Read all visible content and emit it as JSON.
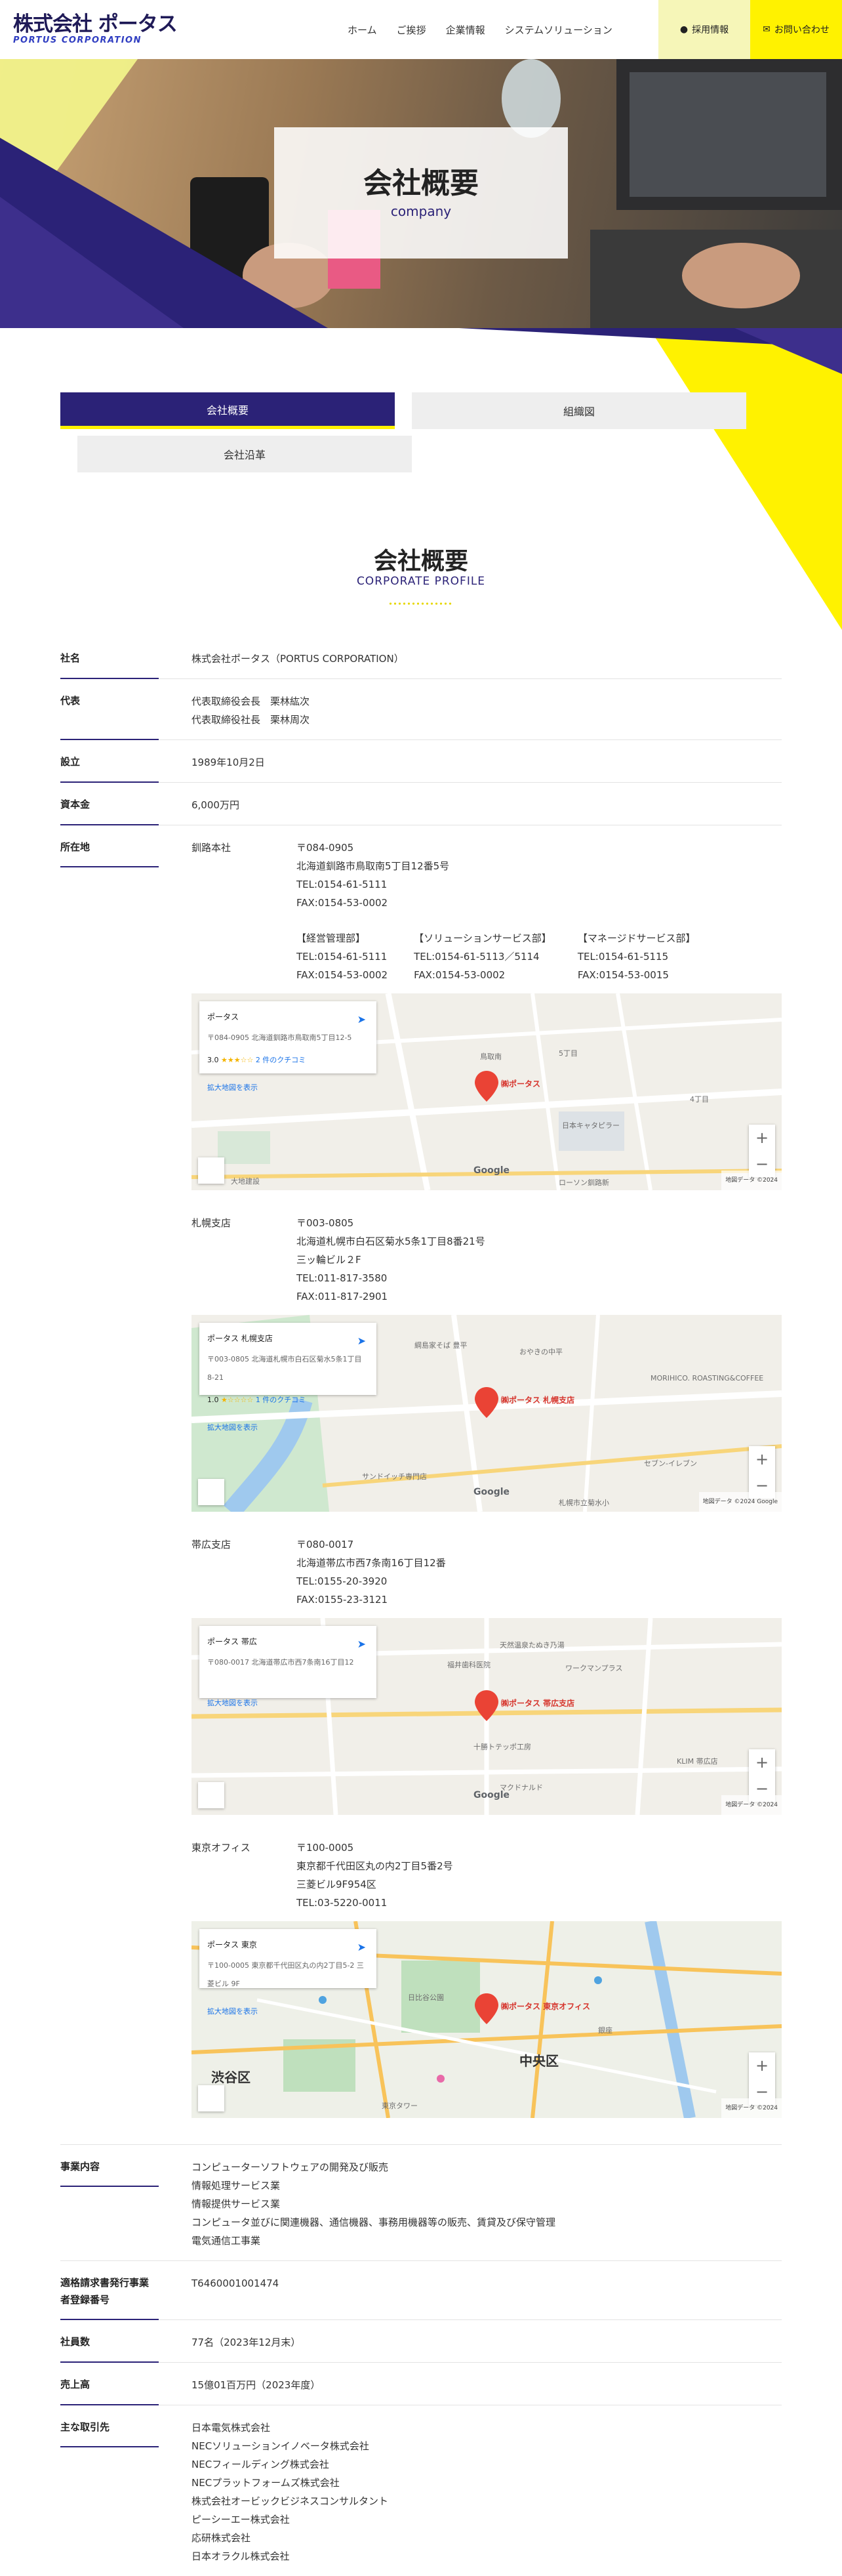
{
  "header": {
    "logo_jp": "株式会社 ポータス",
    "logo_en": "PORTUS CORPORATION",
    "nav": [
      "ホーム",
      "ご挨拶",
      "企業情報",
      "システムソリューション"
    ],
    "recruit_label": "採用情報",
    "contact_label": "お問い合わせ"
  },
  "hero": {
    "title": "会社概要",
    "subtitle": "company"
  },
  "tabs": [
    "会社概要",
    "組織図",
    "会社沿革"
  ],
  "section": {
    "title": "会社概要",
    "subtitle": "CORPORATE PROFILE"
  },
  "profile": {
    "name": {
      "label": "社名",
      "value": "株式会社ポータス（PORTUS CORPORATION）"
    },
    "rep": {
      "label": "代表",
      "lines": [
        "代表取締役会長　栗林紘次",
        "代表取締役社長　栗林周次"
      ]
    },
    "established": {
      "label": "設立",
      "value": "1989年10月2日"
    },
    "capital": {
      "label": "資本金",
      "value": "6,000万円"
    },
    "location": {
      "label": "所在地",
      "hq": {
        "name": "釧路本社",
        "lines": [
          "〒084-0905",
          "北海道釧路市鳥取南5丁目12番5号",
          "TEL:0154-61-5111",
          "FAX:0154-53-0002"
        ],
        "depts": [
          {
            "title": "【経営管理部】",
            "lines": [
              "TEL:0154-61-5111",
              "FAX:0154-53-0002"
            ]
          },
          {
            "title": "【ソリューションサービス部】",
            "lines": [
              "TEL:0154-61-5113／5114",
              "FAX:0154-53-0002"
            ]
          },
          {
            "title": "【マネージドサービス部】",
            "lines": [
              "TEL:0154-61-5115",
              "FAX:0154-53-0015"
            ]
          }
        ],
        "map_card_title": "ポータス",
        "map_card_address": "〒084-0905 北海道釧路市鳥取南5丁目12-5",
        "map_rating": "3.0",
        "map_stars": "★★★☆☆",
        "map_reviews": "2 件のクチコミ",
        "map_link": "拡大地図を表示",
        "map_dir": "ルート",
        "map_pin": "㈱ポータス",
        "map_labels": [
          "鳥取南",
          "5丁目",
          "日本キャタピラー",
          "ローソン釧路新",
          "4丁目",
          "大地建設"
        ],
        "map_copy": "地図データ ©2024"
      },
      "sapporo": {
        "name": "札幌支店",
        "lines": [
          "〒003-0805",
          "北海道札幌市白石区菊水5条1丁目8番21号",
          "三ッ輪ビル２F",
          "TEL:011-817-3580",
          "FAX:011-817-2901"
        ],
        "map_card_title": "ポータス 札幌支店",
        "map_card_address": "〒003-0805 北海道札幌市白石区菊水5条1丁目8-21",
        "map_rating": "1.0",
        "map_stars": "★☆☆☆☆",
        "map_reviews": "1 件のクチコミ",
        "map_link": "拡大地図を表示",
        "map_dir": "ルート",
        "map_pin": "㈱ポータス 札幌支店",
        "map_labels": [
          "綱島家そば 豊平",
          "おやきの中平",
          "MORIHICO. ROASTING&COFFEE",
          "セブン-イレブン",
          "札幌市立菊水小",
          "サンドイッチ専門店"
        ],
        "map_copy": "地図データ ©2024 Google"
      },
      "obihiro": {
        "name": "帯広支店",
        "lines": [
          "〒080-0017",
          "北海道帯広市西7条南16丁目12番",
          "TEL:0155-20-3920",
          "FAX:0155-23-3121"
        ],
        "map_card_title": "ポータス 帯広",
        "map_card_address": "〒080-0017 北海道帯広市西7条南16丁目12",
        "map_link": "拡大地図を表示",
        "map_dir": "ルート",
        "map_pin": "㈱ポータス 帯広支店",
        "map_labels": [
          "天然温泉たぬき乃湯",
          "福井歯科医院",
          "ワークマンプラス",
          "十勝トテッポ工房",
          "マクドナルド",
          "KLIM 帯広店"
        ],
        "map_copy": "地図データ ©2024"
      },
      "tokyo": {
        "name": "東京オフィス",
        "lines": [
          "〒100-0005",
          "東京都千代田区丸の内2丁目5番2号",
          "三菱ビル9F954区",
          "TEL:03-5220-0011"
        ],
        "map_card_title": "ポータス 東京",
        "map_card_address": "〒100-0005 東京都千代田区丸の内2丁目5-2 三菱ビル 9F",
        "map_link": "拡大地図を表示",
        "map_dir": "ルート",
        "map_pin": "㈱ポータス 東京オフィス",
        "map_labels": [
          "渋谷区",
          "中央区",
          "日比谷公園",
          "東京タワー",
          "銀座"
        ],
        "map_copy": "地図データ ©2024"
      }
    },
    "business": {
      "label": "事業内容",
      "lines": [
        "コンピューターソフトウェアの開発及び販売",
        "情報処理サービス業",
        "情報提供サービス業",
        "コンピュータ並びに関連機器、通信機器、事務用機器等の販売、賃貸及び保守管理",
        "電気通信工事業"
      ]
    },
    "invoice": {
      "label_lines": [
        "適格請求書発行事業",
        "者登録番号"
      ],
      "value": "T6460001001474"
    },
    "employees": {
      "label": "社員数",
      "value": "77名（2023年12月末）"
    },
    "sales": {
      "label": "売上高",
      "value": "15億01百万円（2023年度）"
    },
    "clients": {
      "label": "主な取引先",
      "lines": [
        "日本電気株式会社",
        "NECソリューションイノベータ株式会社",
        "NECフィールディング株式会社",
        "NECプラットフォームズ株式会社",
        "株式会社オービックビジネスコンサルタント",
        "ピーシーエー株式会社",
        "応研株式会社",
        "日本オラクル株式会社"
      ]
    }
  },
  "colors": {
    "navy": "#2b2277",
    "yellow": "#fff200",
    "pale_yellow": "#f6f6b8"
  }
}
